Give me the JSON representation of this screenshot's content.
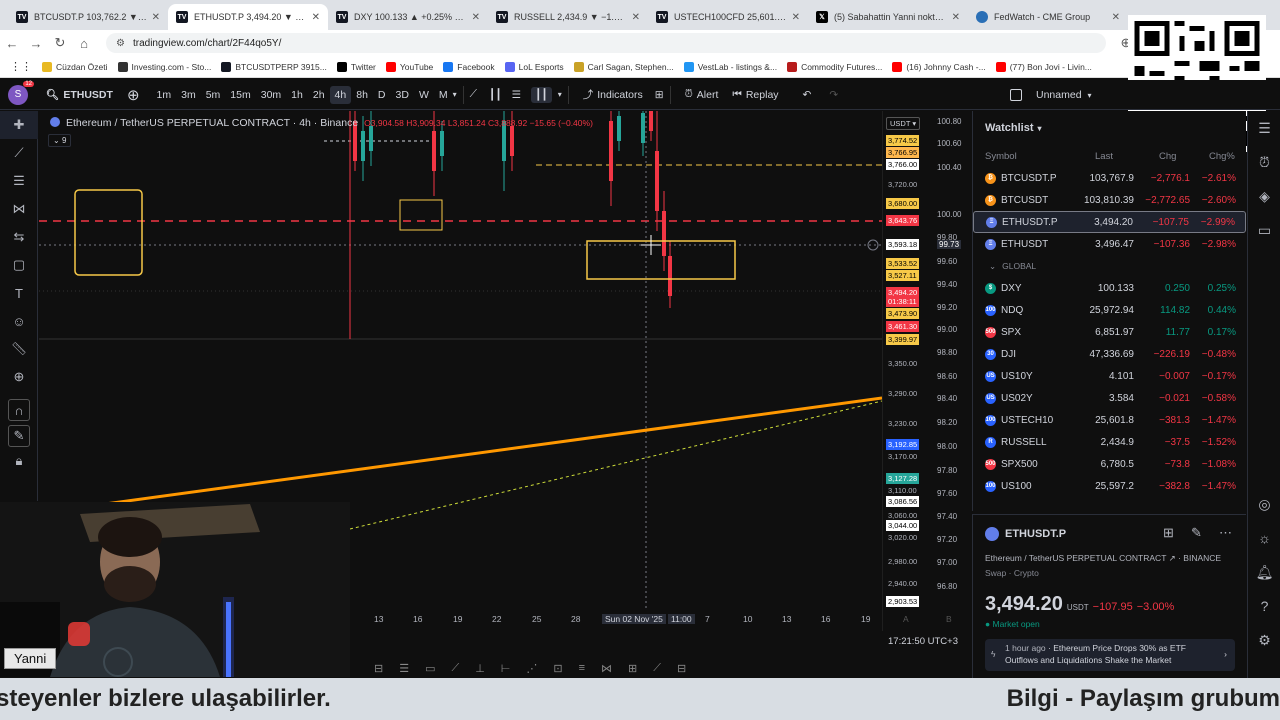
{
  "browser": {
    "tabs": [
      {
        "icon": "TV",
        "title": "BTCUSDT.P 103,762.2 ▼ −2.61%"
      },
      {
        "icon": "TV",
        "title": "ETHUSDT.P 3,494.20 ▼ −3% Unnamed",
        "active": true
      },
      {
        "icon": "TV",
        "title": "DXY 100.133 ▲ +0.25% Unnamed"
      },
      {
        "icon": "TV",
        "title": "RUSSELL 2,434.9 ▼ −1.52% Unnamed"
      },
      {
        "icon": "TV",
        "title": "USTECH100CFD 25,601.8 ▼ −1.47%"
      },
      {
        "icon": "X",
        "title": "(5) Sabahattin Yanni nokta Eteh"
      },
      {
        "icon": "CME",
        "title": "FedWatch - CME Group"
      }
    ],
    "url": "tradingview.com/chart/2F44qo5Y/",
    "bookmarks": [
      {
        "label": "Cüzdan Özeti",
        "color": "#e8b923"
      },
      {
        "label": "Investing.com - Sto...",
        "color": "#333"
      },
      {
        "label": "BTCUSDTPERP 3915...",
        "color": "#131722"
      },
      {
        "label": "Twitter",
        "color": "#000"
      },
      {
        "label": "YouTube",
        "color": "#ff0000"
      },
      {
        "label": "Facebook",
        "color": "#1877f2"
      },
      {
        "label": "LoL Esports",
        "color": "#5865f2"
      },
      {
        "label": "Carl Sagan, Stephen...",
        "color": "#c9a227"
      },
      {
        "label": "VestLab - listings &...",
        "color": "#2196f3"
      },
      {
        "label": "Commodity Futures...",
        "color": "#b71c1c"
      },
      {
        "label": "(16) Johnny Cash -...",
        "color": "#ff0000"
      },
      {
        "label": "(77) Bon Jovi - Livin...",
        "color": "#ff0000"
      }
    ]
  },
  "toolbar": {
    "avatar_letter": "S",
    "avatar_badge": "12",
    "symbol": "ETHUSDT",
    "timeframes": [
      "1m",
      "3m",
      "5m",
      "15m",
      "30m",
      "1h",
      "2h",
      "4h",
      "8h",
      "D",
      "3D",
      "W",
      "M"
    ],
    "active_tf": "4h",
    "indicators": "Indicators",
    "alert": "Alert",
    "replay": "Replay",
    "layout_name": "Unnamed"
  },
  "chart": {
    "legend_title": "Ethereum / TetherUS PERPETUAL CONTRACT · 4h · Binance",
    "ohlc": "O3,904.58 H3,909.34 L3,851.24 C3,888.92 −15.65 (−0.40%)",
    "indicator_count": "9",
    "currency": "USDT",
    "price_labels_left": [
      {
        "v": "3,774.52",
        "bg": "#f7c948",
        "fg": "#000"
      },
      {
        "v": "3,766.95",
        "bg": "#ffb74d",
        "fg": "#000"
      },
      {
        "v": "3,766.00",
        "bg": "#ffffff",
        "fg": "#000"
      },
      {
        "v": "3,720.00",
        "bg": "",
        "fg": "#b2b5be"
      },
      {
        "v": "3,680.00",
        "bg": "#f7c948",
        "fg": "#000"
      },
      {
        "v": "3,643.76",
        "bg": "#f23645",
        "fg": "#fff"
      },
      {
        "v": "3,593.18",
        "bg": "#ffffff",
        "fg": "#000"
      },
      {
        "v": "3,533.52",
        "bg": "#f7c948",
        "fg": "#000"
      },
      {
        "v": "3,527.11",
        "bg": "#f7c948",
        "fg": "#000"
      },
      {
        "v": "3,494.20",
        "bg": "#f23645",
        "fg": "#fff"
      },
      {
        "v": "01:38:11",
        "bg": "#f23645",
        "fg": "#fff"
      },
      {
        "v": "3,473.90",
        "bg": "#f7c948",
        "fg": "#000"
      },
      {
        "v": "3,461.30",
        "bg": "#f23645",
        "fg": "#fff"
      },
      {
        "v": "3,399.97",
        "bg": "#f7c948",
        "fg": "#000"
      },
      {
        "v": "3,350.00",
        "bg": "",
        "fg": "#b2b5be"
      },
      {
        "v": "3,290.00",
        "bg": "",
        "fg": "#b2b5be"
      },
      {
        "v": "3,230.00",
        "bg": "",
        "fg": "#b2b5be"
      },
      {
        "v": "3,192.85",
        "bg": "#2962ff",
        "fg": "#fff"
      },
      {
        "v": "3,170.00",
        "bg": "",
        "fg": "#b2b5be"
      },
      {
        "v": "3,127.28",
        "bg": "#26a69a",
        "fg": "#fff"
      },
      {
        "v": "3,110.00",
        "bg": "",
        "fg": "#b2b5be"
      },
      {
        "v": "3,086.56",
        "bg": "#ffffff",
        "fg": "#000"
      },
      {
        "v": "3,060.00",
        "bg": "",
        "fg": "#b2b5be"
      },
      {
        "v": "3,044.00",
        "bg": "#ffffff",
        "fg": "#000"
      },
      {
        "v": "3,020.00",
        "bg": "",
        "fg": "#b2b5be"
      },
      {
        "v": "2,980.00",
        "bg": "",
        "fg": "#b2b5be"
      },
      {
        "v": "2,940.00",
        "bg": "",
        "fg": "#b2b5be"
      },
      {
        "v": "2,903.53",
        "bg": "#ffffff",
        "fg": "#000"
      }
    ],
    "price_labels_right": [
      "100.80",
      "100.60",
      "100.40",
      "100.00",
      "99.80",
      "99.73",
      "99.60",
      "99.40",
      "99.20",
      "99.00",
      "98.80",
      "98.60",
      "98.40",
      "98.20",
      "98.00",
      "97.80",
      "97.60",
      "97.40",
      "97.20",
      "97.00",
      "96.80"
    ],
    "time_labels": [
      "13",
      "16",
      "19",
      "22",
      "25",
      "28",
      "Sun 02 Nov '25",
      "11:00",
      "7",
      "10",
      "13",
      "16",
      "19",
      "A",
      "B"
    ],
    "clock": "17:21:50 UTC+3"
  },
  "webcam": {
    "name": "Yanni"
  },
  "ticker": {
    "left": "steyenler bizlere ulaşabilirler.",
    "right": "Bilgi - Paylaşım grubum"
  },
  "watchlist": {
    "title": "Watchlist",
    "cols": {
      "symbol": "Symbol",
      "last": "Last",
      "chg": "Chg",
      "chgp": "Chg%"
    },
    "section": "GLOBAL",
    "rows": [
      {
        "icon": "#f7931a",
        "glyph": "₿",
        "name": "BTCUSDT.P",
        "last": "103,767.9",
        "chg": "−2,776.1",
        "chgp": "−2.61%",
        "neg": true
      },
      {
        "icon": "#f7931a",
        "glyph": "₿",
        "name": "BTCUSDT",
        "last": "103,810.39",
        "chg": "−2,772.65",
        "chgp": "−2.60%",
        "neg": true
      },
      {
        "icon": "#627eea",
        "glyph": "Ξ",
        "name": "ETHUSDT.P",
        "last": "3,494.20",
        "chg": "−107.75",
        "chgp": "−2.99%",
        "neg": true,
        "sel": true
      },
      {
        "icon": "#627eea",
        "glyph": "Ξ",
        "name": "ETHUSDT",
        "last": "3,496.47",
        "chg": "−107.36",
        "chgp": "−2.98%",
        "neg": true
      },
      {
        "icon": "#089981",
        "glyph": "$",
        "name": "DXY",
        "last": "100.133",
        "chg": "0.250",
        "chgp": "0.25%",
        "neg": false
      },
      {
        "icon": "#2962ff",
        "glyph": "100",
        "name": "NDQ",
        "last": "25,972.94",
        "chg": "114.82",
        "chgp": "0.44%",
        "neg": false
      },
      {
        "icon": "#f23645",
        "glyph": "500",
        "name": "SPX",
        "last": "6,851.97",
        "chg": "11.77",
        "chgp": "0.17%",
        "neg": false
      },
      {
        "icon": "#2962ff",
        "glyph": "30",
        "name": "DJI",
        "last": "47,336.69",
        "chg": "−226.19",
        "chgp": "−0.48%",
        "neg": true
      },
      {
        "icon": "#2962ff",
        "glyph": "US",
        "name": "US10Y",
        "last": "4.101",
        "chg": "−0.007",
        "chgp": "−0.17%",
        "neg": true
      },
      {
        "icon": "#2962ff",
        "glyph": "US",
        "name": "US02Y",
        "last": "3.584",
        "chg": "−0.021",
        "chgp": "−0.58%",
        "neg": true
      },
      {
        "icon": "#2962ff",
        "glyph": "100",
        "name": "USTECH10",
        "last": "25,601.8",
        "chg": "−381.3",
        "chgp": "−1.47%",
        "neg": true
      },
      {
        "icon": "#2962ff",
        "glyph": "R",
        "name": "RUSSELL",
        "last": "2,434.9",
        "chg": "−37.5",
        "chgp": "−1.52%",
        "neg": true
      },
      {
        "icon": "#f23645",
        "glyph": "500",
        "name": "SPX500",
        "last": "6,780.5",
        "chg": "−73.8",
        "chgp": "−1.08%",
        "neg": true
      },
      {
        "icon": "#2962ff",
        "glyph": "100",
        "name": "US100",
        "last": "25,597.2",
        "chg": "−382.8",
        "chgp": "−1.47%",
        "neg": true
      }
    ]
  },
  "details": {
    "symbol": "ETHUSDT.P",
    "desc": "Ethereum / TetherUS PERPETUAL CONTRACT",
    "exchange": "BINANCE",
    "type": "Swap · Crypto",
    "price_main": "3,494.",
    "price_dec": "20",
    "unit": "USDT",
    "chg": "−107.95",
    "chgp": "−3.00%",
    "status": "Market open",
    "news_time": "1 hour ago",
    "news_text": "Ethereum Price Drops 30% as ETF Outflows and Liquidations Shake the Market"
  }
}
